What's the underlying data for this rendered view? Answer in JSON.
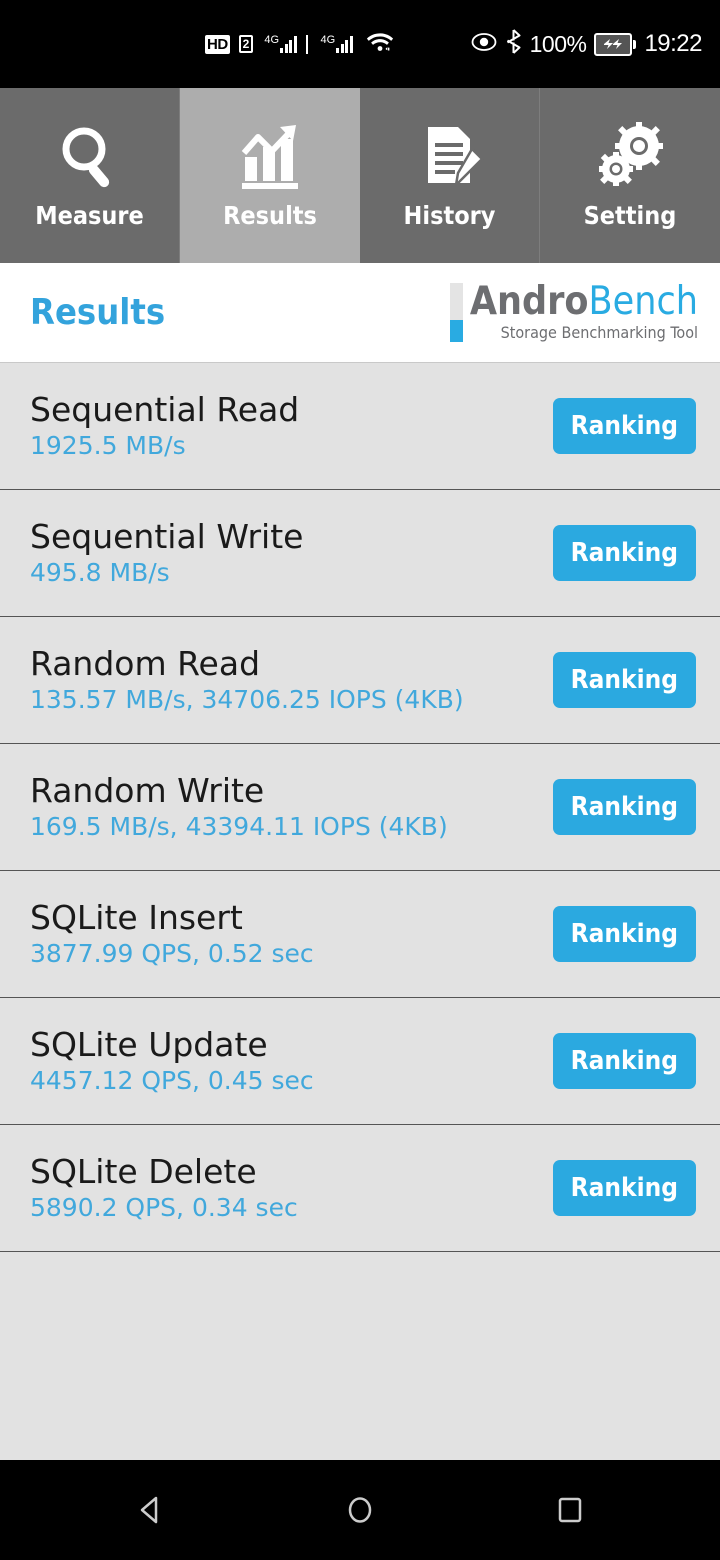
{
  "statusbar": {
    "hd_label": "HD",
    "hd_sim": "2",
    "net1": "4G",
    "net2": "4G",
    "wifi_icon": "wifi-icon",
    "eye_icon": "eye-icon",
    "bluetooth_icon": "bluetooth-icon",
    "battery_percent": "100%",
    "battery_icon": "battery-charging-icon",
    "time": "19:22"
  },
  "tabs": [
    {
      "label": "Measure",
      "icon": "magnifier-icon",
      "active": false
    },
    {
      "label": "Results",
      "icon": "bar-chart-icon",
      "active": true
    },
    {
      "label": "History",
      "icon": "document-pencil-icon",
      "active": false
    },
    {
      "label": "Setting",
      "icon": "gears-icon",
      "active": false
    }
  ],
  "header": {
    "page_title": "Results",
    "logo_primary": "Andro",
    "logo_secondary": "Bench",
    "logo_subtitle": "Storage Benchmarking Tool"
  },
  "results": {
    "ranking_label": "Ranking",
    "items": [
      {
        "title": "Sequential Read",
        "value": "1925.5 MB/s"
      },
      {
        "title": "Sequential Write",
        "value": "495.8 MB/s"
      },
      {
        "title": "Random Read",
        "value": "135.57 MB/s, 34706.25 IOPS (4KB)"
      },
      {
        "title": "Random Write",
        "value": "169.5 MB/s, 43394.11 IOPS (4KB)"
      },
      {
        "title": "SQLite Insert",
        "value": "3877.99 QPS, 0.52 sec"
      },
      {
        "title": "SQLite Update",
        "value": "4457.12 QPS, 0.45 sec"
      },
      {
        "title": "SQLite Delete",
        "value": "5890.2 QPS, 0.34 sec"
      }
    ]
  },
  "navbar": {
    "back": "back-icon",
    "home": "home-icon",
    "recents": "recents-icon"
  },
  "colors": {
    "accent_blue": "#29abe2",
    "value_blue": "#41a8dc",
    "tab_inactive": "#6b6b6b",
    "tab_active": "#adadad",
    "list_bg": "#e2e2e2"
  }
}
